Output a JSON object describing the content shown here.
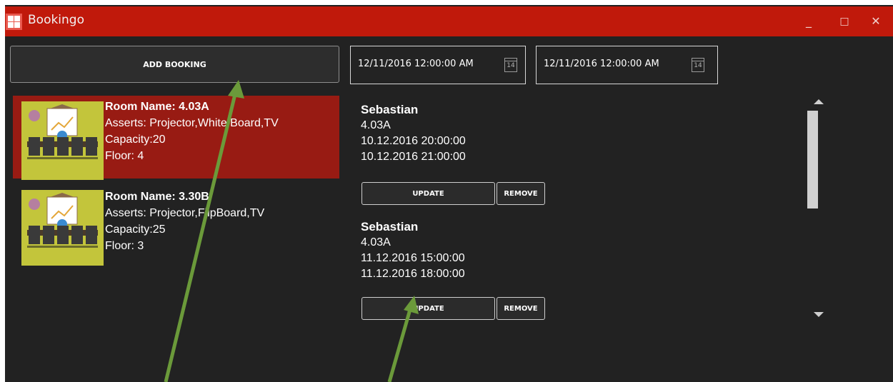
{
  "app": {
    "title": "Bookingo"
  },
  "window_controls": {
    "minimize": "_",
    "maximize": "□",
    "close": "✕"
  },
  "toolbar": {
    "add_booking_label": "ADD BOOKING",
    "start_date": "12/11/2016 12:00:00 AM",
    "end_date": "12/11/2016 12:00:00 AM",
    "calendar_day": "14"
  },
  "rooms": [
    {
      "name": "Room Name: 4.03A",
      "assets": "Asserts: Projector,White Board,TV",
      "capacity": "Capacity:20",
      "floor": "Floor: 4",
      "selected": true
    },
    {
      "name": "Room Name: 3.30B",
      "assets": "Asserts: Projector,FlipBoard,TV",
      "capacity": "Capacity:25",
      "floor": "Floor: 3",
      "selected": false
    }
  ],
  "bookings": [
    {
      "person": "Sebastian",
      "room": "4.03A",
      "start": "10.12.2016 20:00:00",
      "end": "10.12.2016 21:00:00",
      "update_label": "UPDATE",
      "remove_label": "REMOVE"
    },
    {
      "person": "Sebastian",
      "room": "4.03A",
      "start": "11.12.2016 15:00:00",
      "end": "11.12.2016 18:00:00",
      "update_label": "UPDATE",
      "remove_label": "REMOVE"
    }
  ],
  "colors": {
    "titlebar": "#c0190b",
    "background": "#222222",
    "selected_room": "#981b13",
    "annotation_arrow": "#6b9a3a"
  }
}
